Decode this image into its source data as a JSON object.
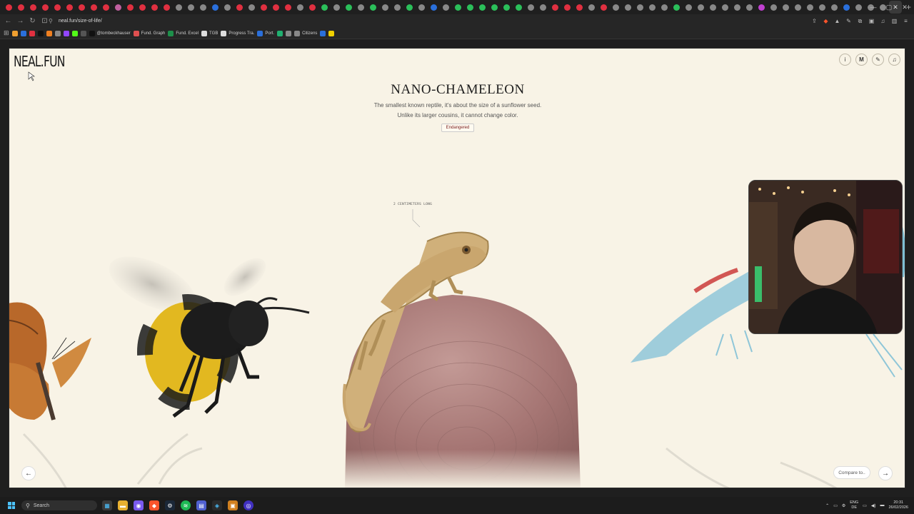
{
  "browser": {
    "url": "neal.fun/size-of-life/",
    "tab_icon_colors": [
      "#e03040",
      "#e03040",
      "#e03040",
      "#e03040",
      "#e03040",
      "#e03040",
      "#e03040",
      "#e03040",
      "#e03040",
      "#c060a0",
      "#e03040",
      "#e03040",
      "#e03040",
      "#e03040",
      "#888888",
      "#888888",
      "#888888",
      "#2a6fdb",
      "#888888",
      "#e03040",
      "#888888",
      "#e03040",
      "#e03040",
      "#e03040",
      "#888888",
      "#e03040",
      "#2bbf5a",
      "#888888",
      "#2bbf5a",
      "#888888",
      "#2bbf5a",
      "#888888",
      "#888888",
      "#2bbf5a",
      "#888888",
      "#2a6fdb",
      "#888888",
      "#2bbf5a",
      "#2bbf5a",
      "#2bbf5a",
      "#2bbf5a",
      "#2bbf5a",
      "#2bbf5a",
      "#888888",
      "#888888",
      "#e03040",
      "#e03040",
      "#e03040",
      "#888888",
      "#e03040",
      "#888888",
      "#888888",
      "#888888",
      "#888888",
      "#888888",
      "#2bbf5a",
      "#888888",
      "#888888",
      "#888888",
      "#888888",
      "#888888",
      "#888888",
      "#c040d0",
      "#888888",
      "#888888",
      "#888888",
      "#888888",
      "#888888",
      "#888888",
      "#2a6fdb",
      "#888888",
      "#888888",
      "#888888"
    ],
    "bookmarks": [
      {
        "label": "",
        "color": "#f0a030"
      },
      {
        "label": "",
        "color": "#2a6fdb"
      },
      {
        "label": "",
        "color": "#e03040"
      },
      {
        "label": "",
        "color": "#111111"
      },
      {
        "label": "",
        "color": "#f08020"
      },
      {
        "label": "",
        "color": "#888888"
      },
      {
        "label": "",
        "color": "#9146ff"
      },
      {
        "label": "",
        "color": "#53fc18"
      },
      {
        "label": "",
        "color": "#555555"
      },
      {
        "label": "@tombeckhauser",
        "color": "#111111"
      },
      {
        "label": "Fund. Graph",
        "color": "#e05050"
      },
      {
        "label": "Fund. Excel",
        "color": "#1d8f4a"
      },
      {
        "label": "TGB",
        "color": "#dddddd"
      },
      {
        "label": "Progress Tra.",
        "color": "#dddddd"
      },
      {
        "label": "Port.",
        "color": "#2a6fdb"
      },
      {
        "label": "",
        "color": "#20b070"
      },
      {
        "label": "",
        "color": "#888888"
      },
      {
        "label": "Citizens",
        "color": "#888888"
      },
      {
        "label": "",
        "color": "#2a6fdb"
      },
      {
        "label": "",
        "color": "#f0d000"
      }
    ]
  },
  "page": {
    "logo": "NEAL.FUN",
    "title": "NANO-CHAMELEON",
    "description_line1": "The smallest known reptile, it's about the size of a sunflower seed.",
    "description_line2": "Unlike its larger cousins, it cannot change color.",
    "status_badge": "Endangered",
    "measurement_label": "2 CENTIMETERS LONG",
    "compare_button": "Compare to..",
    "top_icons": [
      "info-icon",
      "m-icon",
      "pencil-icon",
      "music-icon"
    ]
  },
  "taskbar": {
    "search_placeholder": "Search",
    "language_top": "ENG",
    "language_bottom": "DE",
    "time": "20:31",
    "date": "26/02/2026"
  }
}
